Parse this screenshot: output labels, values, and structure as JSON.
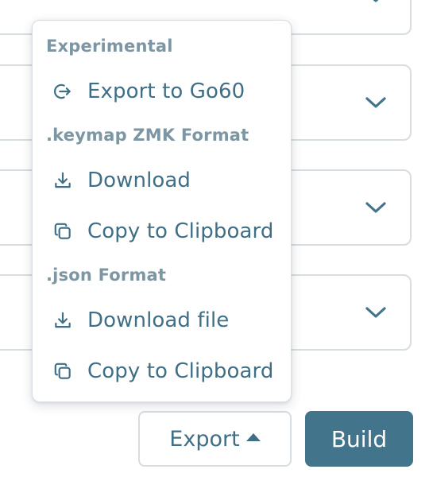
{
  "colors": {
    "accent": "#42758c",
    "menu_text": "#3f6f86",
    "section_text": "#7d96a3",
    "border": "#d7dde1"
  },
  "background_selects": [
    {
      "icon": "chevron-down-icon"
    },
    {
      "icon": "chevron-down-icon"
    },
    {
      "icon": "chevron-down-icon"
    },
    {
      "icon": "chevron-down-icon"
    }
  ],
  "menu": {
    "sections": [
      {
        "title": "Experimental",
        "items": [
          {
            "label": "Export to Go60",
            "icon": "export-arrow-icon"
          }
        ]
      },
      {
        "title": ".keymap ZMK Format",
        "items": [
          {
            "label": "Download",
            "icon": "download-icon"
          },
          {
            "label": "Copy to Clipboard",
            "icon": "copy-icon"
          }
        ]
      },
      {
        "title": ".json Format",
        "items": [
          {
            "label": "Download file",
            "icon": "download-icon"
          },
          {
            "label": "Copy to Clipboard",
            "icon": "copy-icon"
          }
        ]
      }
    ]
  },
  "footer": {
    "export_label": "Export",
    "export_icon": "caret-up-icon",
    "build_label": "Build"
  }
}
